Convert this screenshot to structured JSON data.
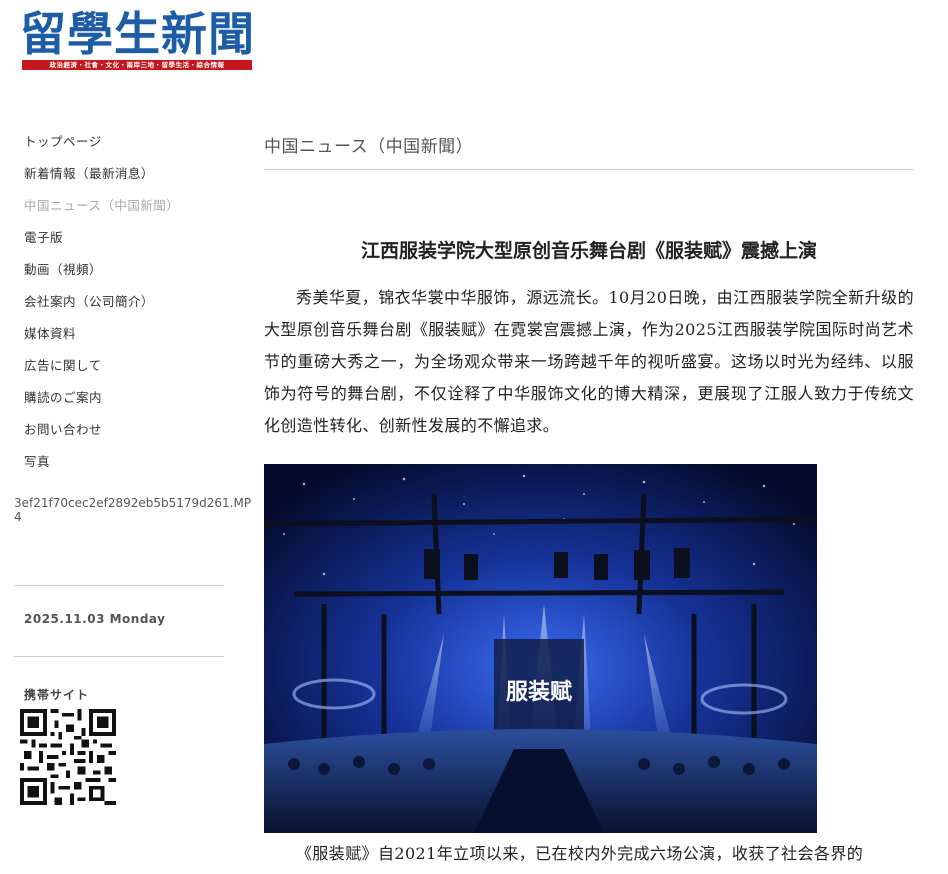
{
  "logo": {
    "title": "留學生新聞",
    "strip": "政治經濟・社會・文化・兩岸三地・留學生活・綜合情報"
  },
  "sidebar": {
    "nav": [
      {
        "label": "トップページ",
        "active": false
      },
      {
        "label": "新着情報（最新消息）",
        "active": false
      },
      {
        "label": "中国ニュース（中国新聞）",
        "active": true
      },
      {
        "label": "電子版",
        "active": false
      },
      {
        "label": "動画（視頻）",
        "active": false
      },
      {
        "label": "会社案内（公司簡介）",
        "active": false
      },
      {
        "label": "媒体資料",
        "active": false
      },
      {
        "label": "広告に関して",
        "active": false
      },
      {
        "label": "購読のご案内",
        "active": false
      },
      {
        "label": "お問い合わせ",
        "active": false
      },
      {
        "label": "写真",
        "active": false
      }
    ],
    "filename": "3ef21f70cec2ef2892eb5b5179d261.MP4",
    "date": "2025.11.03 Monday",
    "mobile_label": "携帯サイト"
  },
  "main": {
    "category": "中国ニュース（中国新聞）",
    "article": {
      "title": "江西服装学院大型原创音乐舞台剧《服装赋》震撼上演",
      "para1": "秀美华夏，锦衣华裳中华服饰，源远流长。10月20日晚，由江西服装学院全新升级的大型原创音乐舞台剧《服装赋》在霓裳宫震撼上演，作为2025江西服装学院国际时尚艺术节的重磅大秀之一，为全场观众带来一场跨越千年的视听盛宴。这场以时光为经纬、以服饰为符号的舞台剧，不仅诠释了中华服饰文化的博大精深，更展现了江服人致力于传统文化创造性转化、创新性发展的不懈追求。",
      "para2": "《服装赋》自2021年立项以来，已在校内外完成六场公演，收获了社会各界的",
      "photo_text": "服装赋"
    }
  },
  "colors": {
    "logo_blue": "#1d5da8",
    "logo_red": "#c8161d",
    "stage_blue": "#1a3fb0"
  }
}
